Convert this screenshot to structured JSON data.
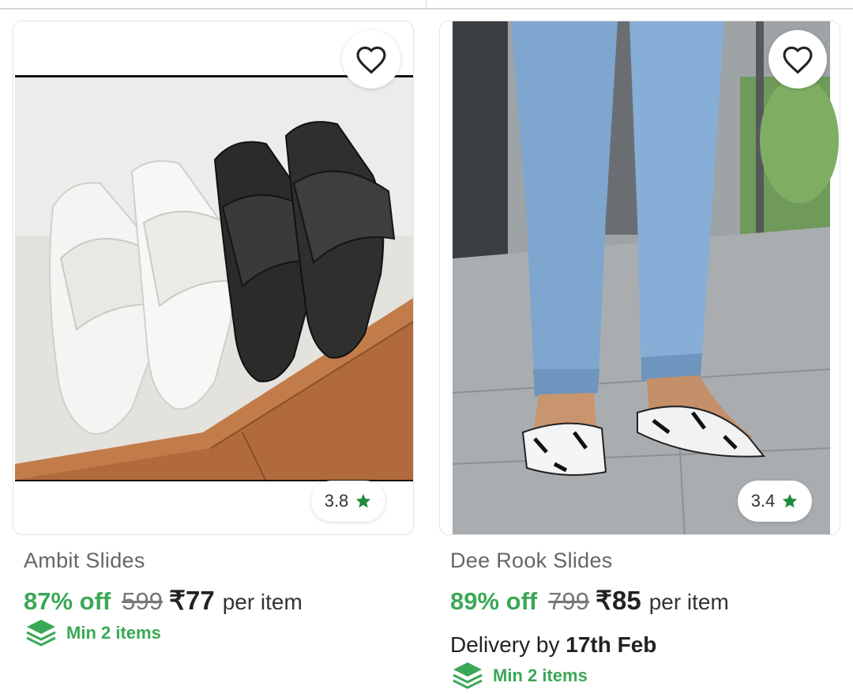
{
  "products": [
    {
      "title": "Ambit Slides",
      "rating": "3.8",
      "discount": "87% off",
      "mrp": "599",
      "price": "₹77",
      "per": "per item",
      "min_items": "Min 2 items",
      "image": "white-and-black-slides-photo"
    },
    {
      "title": "Dee Rook Slides",
      "rating": "3.4",
      "discount": "89% off",
      "mrp": "799",
      "price": "₹85",
      "per": "per item",
      "delivery_prefix": "Delivery by",
      "delivery_date": "17th Feb",
      "min_items": "Min 2 items",
      "image": "person-wearing-cow-print-slides-photo"
    }
  ],
  "colors": {
    "discount_green": "#3aa856",
    "star_green": "#1f8a3b"
  },
  "icons": [
    "heart-icon",
    "star-icon",
    "stack-icon"
  ]
}
